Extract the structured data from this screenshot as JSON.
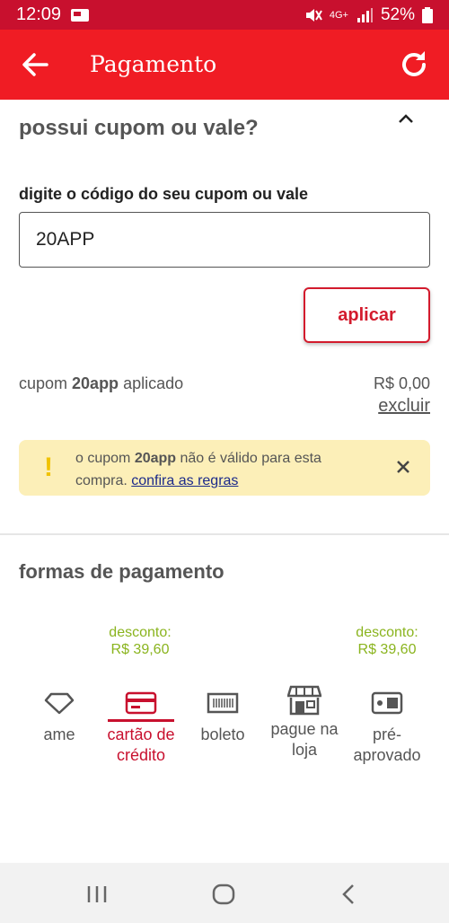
{
  "status_bar": {
    "time": "12:09",
    "battery": "52%",
    "network": "4G+"
  },
  "app_bar": {
    "title": "Pagamento",
    "back_icon": "arrow-left-icon",
    "refresh_icon": "refresh-icon"
  },
  "coupon": {
    "title": "possui cupom ou vale?",
    "field_label": "digite o código do seu cupom ou vale",
    "code_value": "20APP",
    "apply_label": "aplicar",
    "applied_prefix": "cupom ",
    "applied_code": "20app",
    "applied_suffix": " aplicado",
    "applied_value": "R$ 0,00",
    "remove_label": "excluir"
  },
  "warning": {
    "prefix": "o cupom ",
    "code": "20app",
    "suffix": " não é válido para esta compra. ",
    "link": "confira as regras"
  },
  "payment": {
    "title": "formas de pagamento",
    "discounts": [
      {
        "label": "desconto:",
        "value": "R$ 39,60"
      },
      {
        "label": "desconto:",
        "value": "R$ 39,60"
      }
    ],
    "options": [
      {
        "label": "ame",
        "icon": "diamond-icon"
      },
      {
        "label": "cartão de crédito",
        "icon": "credit-card-icon",
        "selected": true
      },
      {
        "label": "boleto",
        "icon": "barcode-icon"
      },
      {
        "label": "pague na loja",
        "icon": "store-icon"
      },
      {
        "label": "pré-aprovado",
        "icon": "preapproved-card-icon"
      }
    ]
  },
  "colors": {
    "brand": "#f01c24",
    "status": "#c8102e",
    "discount": "#8ab41e",
    "warning_bg": "#fcefb8"
  }
}
